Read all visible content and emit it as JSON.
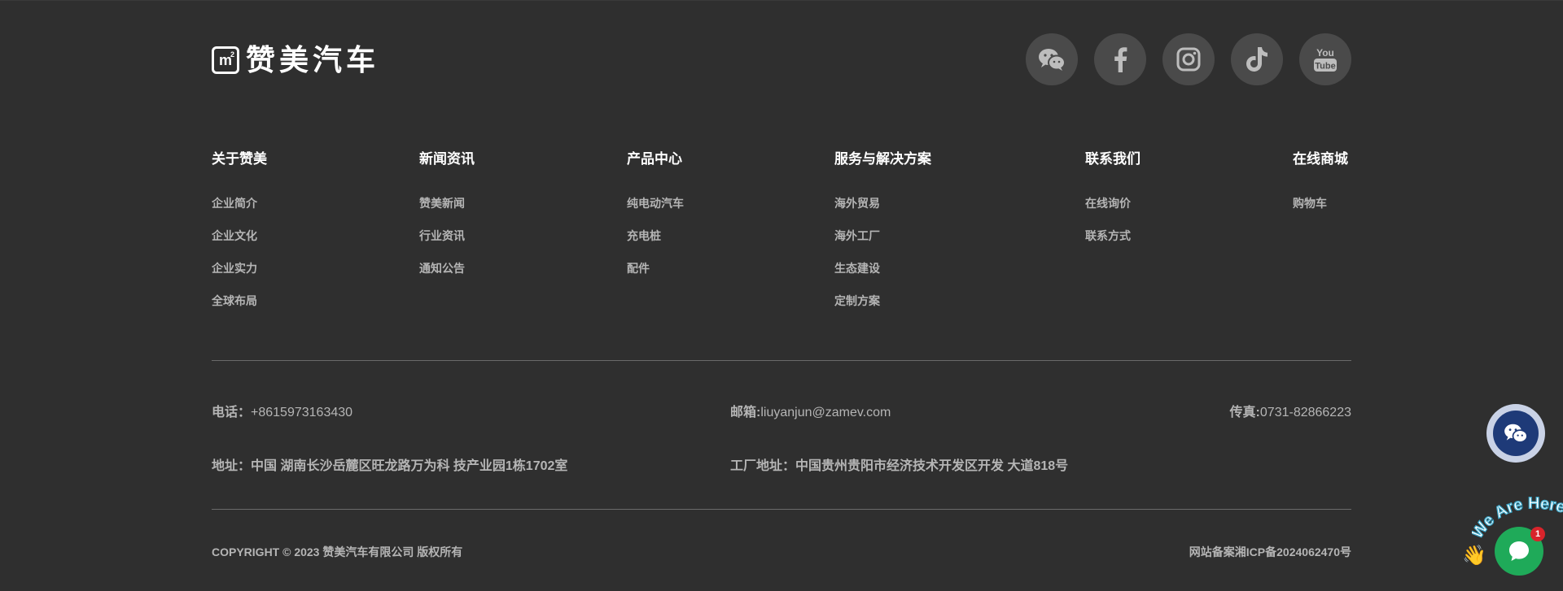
{
  "brand": {
    "logo_mark": "m",
    "logo_sup": "2",
    "name": "赞美汽车"
  },
  "social": [
    {
      "icon": "wechat-icon"
    },
    {
      "icon": "facebook-icon"
    },
    {
      "icon": "instagram-icon"
    },
    {
      "icon": "tiktok-icon"
    },
    {
      "icon": "youtube-icon",
      "label_top": "You",
      "label_bottom": "Tube"
    }
  ],
  "columns": [
    {
      "title": "关于赞美",
      "items": [
        "企业简介",
        "企业文化",
        "企业实力",
        "全球布局"
      ]
    },
    {
      "title": "新闻资讯",
      "items": [
        "赞美新闻",
        "行业资讯",
        "通知公告"
      ]
    },
    {
      "title": "产品中心",
      "items": [
        "纯电动汽车",
        "充电桩",
        "配件"
      ]
    },
    {
      "title": "服务与解决方案",
      "items": [
        "海外贸易",
        "海外工厂",
        "生态建设",
        "定制方案"
      ]
    },
    {
      "title": "联系我们",
      "items": [
        "在线询价",
        "联系方式"
      ]
    },
    {
      "title": "在线商城",
      "items": [
        "购物车"
      ]
    }
  ],
  "contact": {
    "phone_label": "电话：",
    "phone": "+8615973163430",
    "email_label": "邮箱:",
    "email": "liuyanjun@zamev.com",
    "fax_label": "传真:",
    "fax": "0731-82866223",
    "address_label": "地址：",
    "address": "中国 湖南长沙岳麓区旺龙路万为科 技产业园1栋1702室",
    "factory_label": "工厂地址：",
    "factory": "中国贵州贵阳市经济技术开发区开发 大道818号"
  },
  "bottom": {
    "copyright": "COPYRIGHT © 2023 赞美汽车有限公司 版权所有",
    "icp": "网站备案湘ICP备2024062470号"
  },
  "widgets": {
    "chat_banner": "We Are Here!",
    "chat_badge": "1",
    "chat_wave": "👋"
  },
  "colors": {
    "background": "#2f2f2f",
    "social_circle": "#4a4a4a",
    "chat_green": "#1faa59",
    "badge_red": "#d8242b",
    "wechat_float": "#1e3a78"
  }
}
